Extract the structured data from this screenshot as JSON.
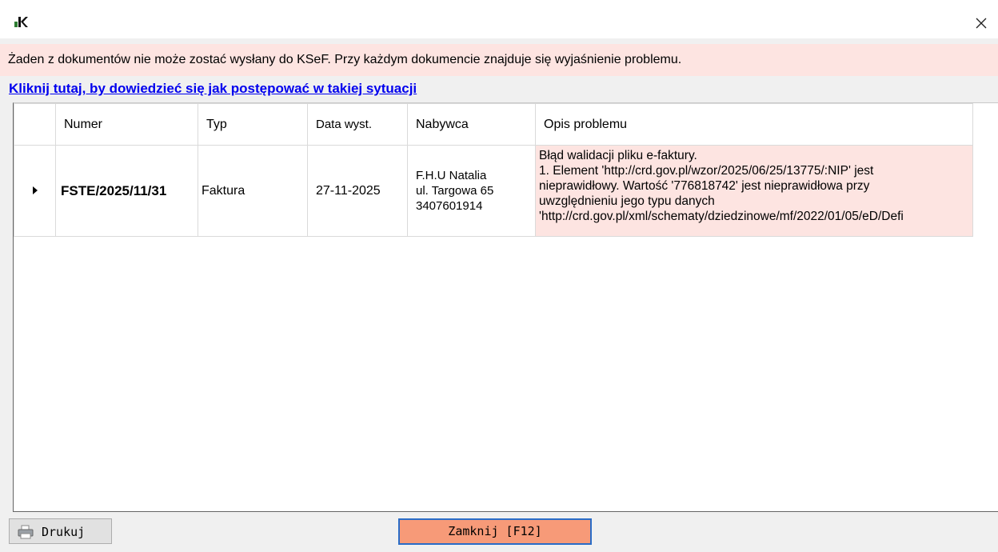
{
  "window": {
    "app_logo": "K",
    "close_symbol": "×"
  },
  "banner": {
    "text": "Żaden z dokumentów nie może zostać wysłany do KSeF. Przy każdym dokumencie znajduje się wyjaśnienie problemu."
  },
  "help_link": {
    "text": "Kliknij tutaj, by dowiedzieć się jak postępować w takiej sytuacji"
  },
  "grid": {
    "columns": [
      "Numer",
      "Typ",
      "Data wyst.",
      "Nabywca",
      "Opis problemu"
    ],
    "rows": [
      {
        "numer": "FSTE/2025/11/31",
        "typ": "Faktura",
        "data": "27-11-2025",
        "nabywca": [
          "F.H.U Natalia",
          "ul. Targowa 65",
          "3407601914"
        ],
        "opis": [
          "Błąd walidacji pliku e-faktury.",
          "1. Element 'http://crd.gov.pl/wzor/2025/06/25/13775/:NIP' jest",
          "nieprawidłowy. Wartość '776818742' jest nieprawidłowa przy",
          "uwzględnieniu jego typu danych",
          "'http://crd.gov.pl/xml/schematy/dziedzinowe/mf/2022/01/05/eD/Defi"
        ]
      }
    ]
  },
  "buttons": {
    "print": "Drukuj",
    "close": "Zamknij [F12]"
  },
  "colors": {
    "error_bg": "#fde4e1",
    "close_button_bg": "#f79a78",
    "link": "#0000ee"
  }
}
